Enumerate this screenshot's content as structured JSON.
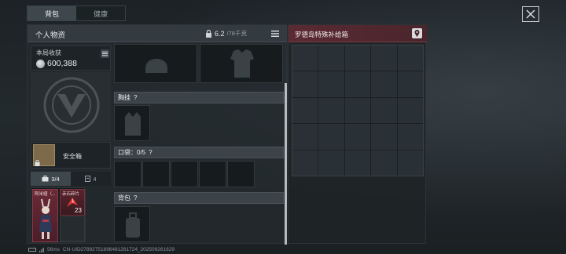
{
  "tabs": [
    {
      "label": "背包",
      "active": true
    },
    {
      "label": "健康",
      "active": false
    }
  ],
  "panel": {
    "title": "个人物资",
    "weight_current": "6.2",
    "weight_max": "/78千克"
  },
  "income": {
    "label": "本局收获",
    "value": "600,388"
  },
  "safebox": {
    "label": "安全箱"
  },
  "bag_tabs": [
    {
      "label": "3/4",
      "icon": "backpack-icon",
      "active": true
    },
    {
      "label": "4",
      "icon": "case-icon",
      "active": false
    }
  ],
  "items": {
    "character_name": "阿米娅（...",
    "red_item_name": "赤石碎片",
    "red_item_count": "23"
  },
  "sections": {
    "chest_rig": "胸挂",
    "pockets": "口袋：0/5",
    "backpack": "背包",
    "help_mark": "?"
  },
  "right": {
    "title": "罗德岛特殊补给箱"
  },
  "status": {
    "ping": "56ms",
    "uid": "CN·UID2789275189648126172​4_20250926​1629"
  },
  "colors": {
    "accent_red": "#5a2a33",
    "panel_bg": "#242a2e",
    "text": "#e9ecee"
  }
}
